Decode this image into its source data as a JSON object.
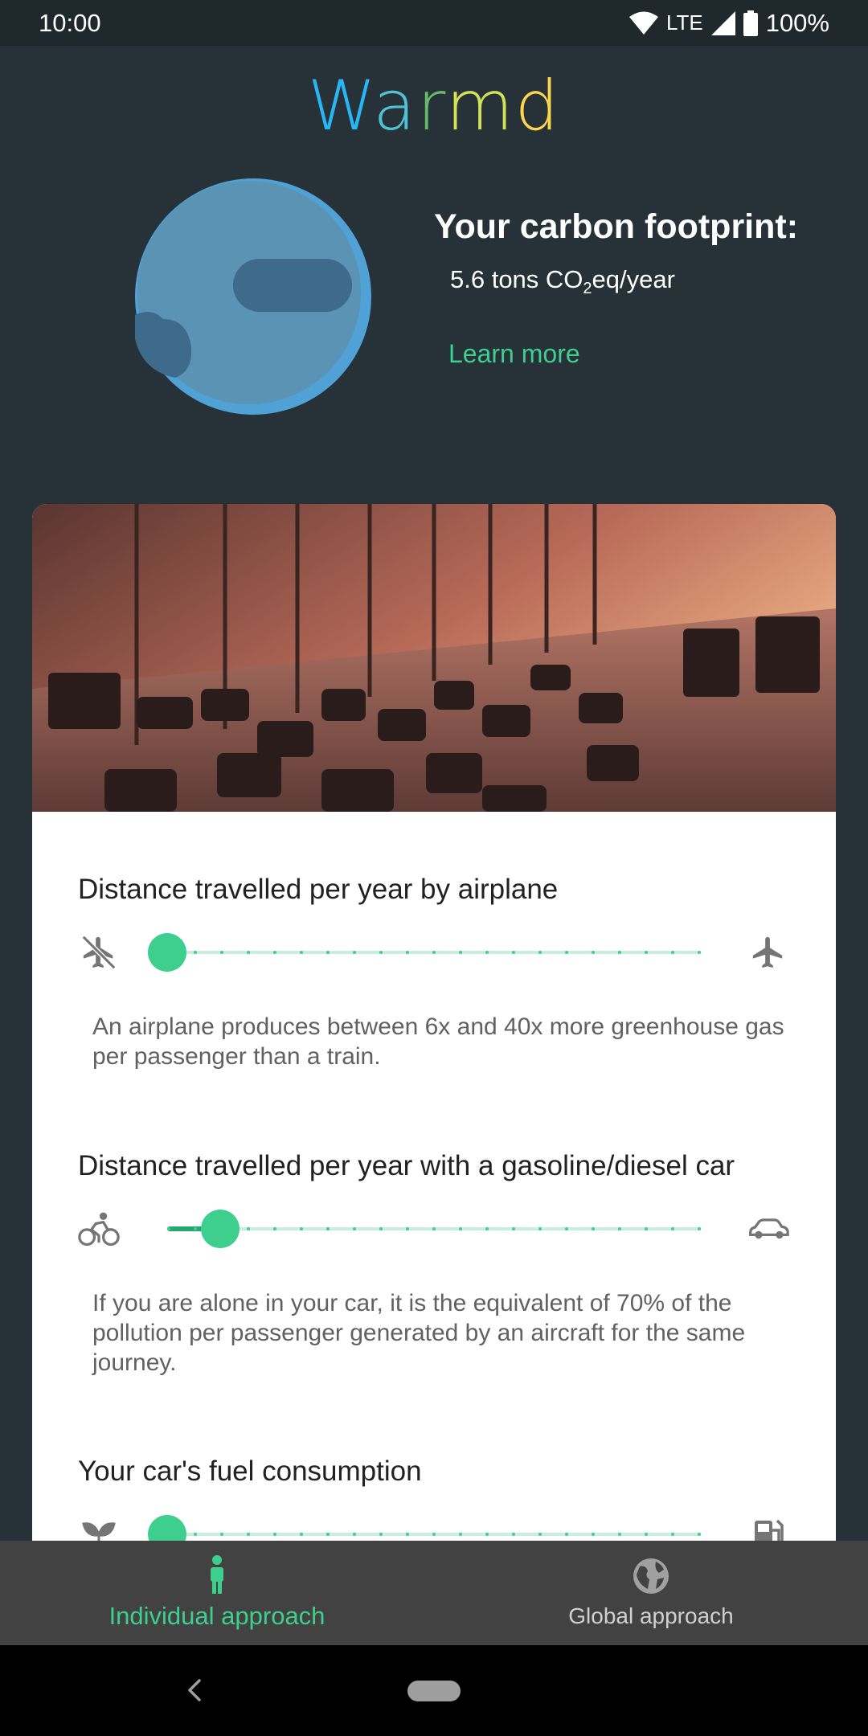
{
  "status_bar": {
    "time": "10:00",
    "network": "LTE",
    "battery": "100%",
    "icons": [
      "wifi-icon",
      "signal-icon",
      "battery-icon"
    ]
  },
  "app": {
    "title_letters": [
      "W",
      "a",
      "r",
      "m",
      "d"
    ],
    "title_colors": [
      "#29b6f6",
      "#29b6f6",
      "#66bb6a",
      "#ffee58",
      "#ffca28"
    ]
  },
  "footprint": {
    "title": "Your carbon footprint:",
    "value_prefix": "5.6 tons CO",
    "value_subscript": "2",
    "value_suffix": "eq/year",
    "learn_more": "Learn more",
    "globe_icon": "earth-globe-icon"
  },
  "sections": [
    {
      "title": "Distance travelled per year by airplane",
      "description": "An airplane produces between 6x and 40x more greenhouse gas per passenger than a train.",
      "left_icon": "no-airplane-icon",
      "right_icon": "airplane-icon",
      "slider_value": 0
    },
    {
      "title": "Distance travelled per year with a gasoline/diesel car",
      "description": "If you are alone in your car, it is the equivalent of 70% of the pollution per passenger generated by an aircraft for the same journey.",
      "left_icon": "bicycle-icon",
      "right_icon": "car-icon",
      "slider_value": 0.1
    },
    {
      "title": "Your car's fuel consumption",
      "left_icon": "leaf-icon",
      "right_icon": "fuel-pump-icon",
      "slider_value": 0
    }
  ],
  "bottom_nav": {
    "items": [
      {
        "label": "Individual approach",
        "icon": "person-icon",
        "active": true
      },
      {
        "label": "Global approach",
        "icon": "globe-icon",
        "active": false
      }
    ]
  },
  "colors": {
    "accent": "#3ecf8e",
    "background": "#263238",
    "card": "#ffffff"
  }
}
